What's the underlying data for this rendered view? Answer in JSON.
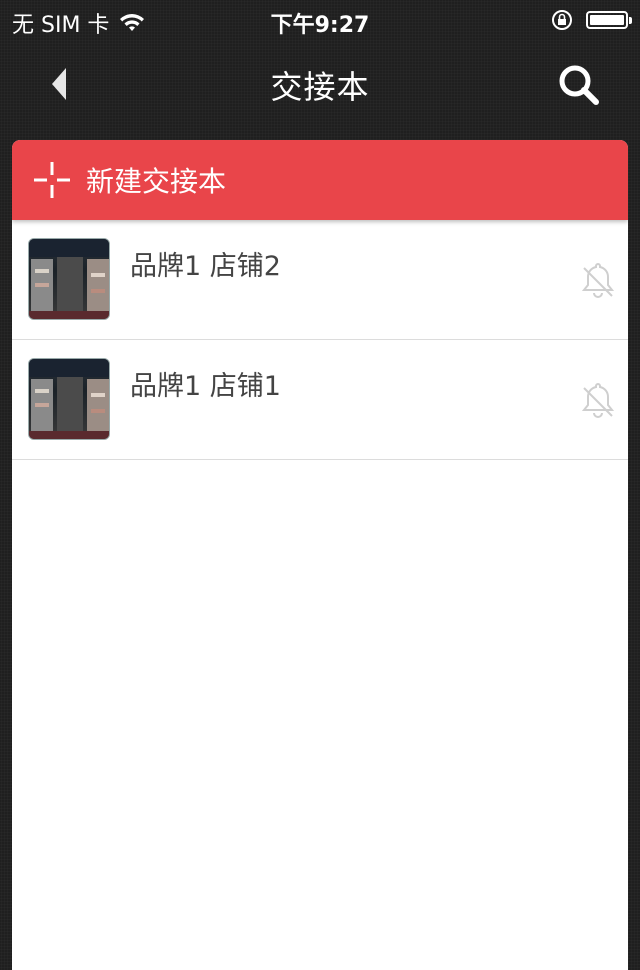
{
  "statusbar": {
    "carrier": "无 SIM 卡",
    "time": "下午9:27"
  },
  "navbar": {
    "title": "交接本",
    "back_icon": "chevron-left-icon",
    "search_icon": "search-icon"
  },
  "new_button": {
    "label": "新建交接本",
    "icon": "plus-icon"
  },
  "items": [
    {
      "title": "品牌1 店铺2",
      "thumb": "store-thumbnail",
      "bell": "bell-off-icon"
    },
    {
      "title": "品牌1 店铺1",
      "thumb": "store-thumbnail",
      "bell": "bell-off-icon"
    }
  ],
  "colors": {
    "accent": "#e9454a",
    "background": "#1f1f1f",
    "card": "#ffffff"
  }
}
